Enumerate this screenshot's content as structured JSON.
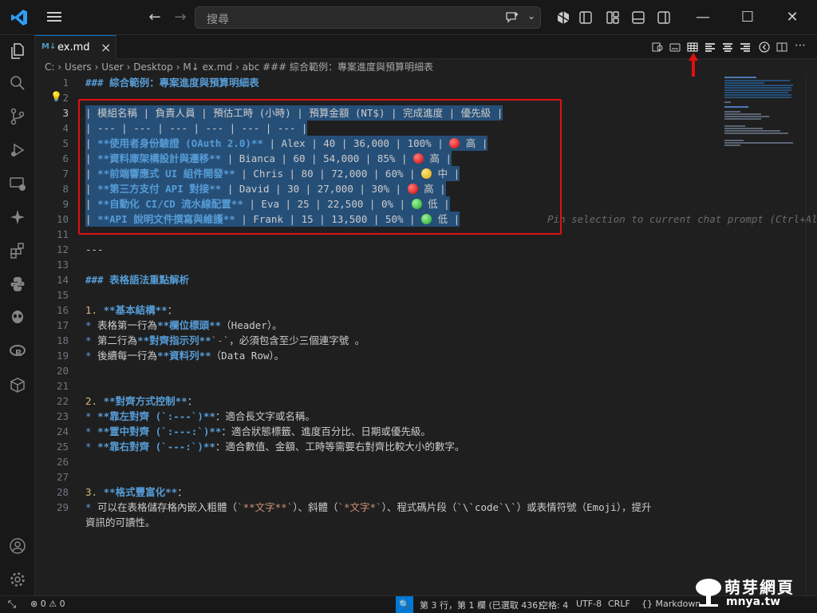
{
  "titlebar": {
    "search_placeholder": "搜尋",
    "menu_icon": "hamburger-menu-icon",
    "window_controls": [
      "minimize",
      "maximize",
      "close"
    ]
  },
  "tab": {
    "icon": "M↓",
    "label": "ex.md"
  },
  "breadcrumb": [
    "C:",
    "Users",
    "User",
    "Desktop",
    "M↓ ex.md",
    "abc ### 綜合範例：專案進度與預算明細表"
  ],
  "editor": {
    "ghost_text": "Pin selection to current chat prompt (Ctrl+Alt+X",
    "lines": [
      {
        "n": "1",
        "text": "### 綜合範例：專案進度與預算明細表"
      },
      {
        "n": "2",
        "text": ""
      },
      {
        "n": "3",
        "text": "| 模組名稱 | 負責人員 | 預估工時 (小時) | 預算金額 (NT$) | 完成進度 | 優先級 |"
      },
      {
        "n": "4",
        "text": "| --- | --- | --- | --- | --- | --- |"
      },
      {
        "n": "5",
        "pre": "| ",
        "b": "**使用者身份驗證 (OAuth 2.0)**",
        "post": " | Alex | 40 | 36,000 | 100% | ",
        "emoji": "red",
        "tail": " 高 |"
      },
      {
        "n": "6",
        "pre": "| ",
        "b": "**資料庫架構設計與遷移**",
        "post": " | Bianca | 60 | 54,000 | 85% | ",
        "emoji": "red",
        "tail": " 高 |"
      },
      {
        "n": "7",
        "pre": "| ",
        "b": "**前端響應式 UI 組件開發**",
        "post": " | Chris | 80 | 72,000 | 60% | ",
        "emoji": "yellow",
        "tail": " 中 |"
      },
      {
        "n": "8",
        "pre": "| ",
        "b": "**第三方支付 API 對接**",
        "post": " | David | 30 | 27,000 | 30% | ",
        "emoji": "red",
        "tail": " 高 |"
      },
      {
        "n": "9",
        "pre": "| ",
        "b": "**自動化 CI/CD 流水線配置**",
        "post": " | Eva | 25 | 22,500 | 0% | ",
        "emoji": "green",
        "tail": " 低 |"
      },
      {
        "n": "10",
        "pre": "| ",
        "b": "**API 說明文件撰寫與維護**",
        "post": " | Frank | 15 | 13,500 | 50% | ",
        "emoji": "green",
        "tail": " 低 |"
      },
      {
        "n": "11",
        "text": ""
      },
      {
        "n": "12",
        "text": "---"
      },
      {
        "n": "13",
        "text": ""
      },
      {
        "n": "14",
        "text": "### 表格語法重點解析"
      },
      {
        "n": "15",
        "text": ""
      },
      {
        "n": "16",
        "num": "1.",
        "b": "**基本結構**",
        "post": "："
      },
      {
        "n": "17",
        "bul": "*",
        "pre": " 表格第一行為",
        "b": "**欄位標頭**",
        "post": "（Header）。"
      },
      {
        "n": "18",
        "bul": "*",
        "pre": " 第二行為",
        "b": "**對齊指示列**",
        "post": "，必須包含至少三個連字號 ",
        "ic": "`-`",
        "tail": "。"
      },
      {
        "n": "19",
        "bul": "*",
        "pre": " 後續每一行為",
        "b": "**資料列**",
        "post": "（Data Row）。"
      },
      {
        "n": "20",
        "text": ""
      },
      {
        "n": "21",
        "text": ""
      },
      {
        "n": "22",
        "num": "2.",
        "b": "**對齊方式控制**",
        "post": "："
      },
      {
        "n": "23",
        "bul": "*",
        "pre": " ",
        "b": "**靠左對齊 (`:---`)**",
        "post": "：適合長文字或名稱。"
      },
      {
        "n": "24",
        "bul": "*",
        "pre": " ",
        "b": "**置中對齊 (`:---:`)**",
        "post": "：適合狀態標籤、進度百分比、日期或優先級。"
      },
      {
        "n": "25",
        "bul": "*",
        "pre": " ",
        "b": "**靠右對齊 (`---:`)**",
        "post": "：適合數值、金額、工時等需要右對齊比較大小的數字。"
      },
      {
        "n": "26",
        "text": ""
      },
      {
        "n": "27",
        "text": ""
      },
      {
        "n": "28",
        "num": "3.",
        "b": "**格式豐富化**",
        "post": "："
      },
      {
        "n": "29",
        "bul": "*",
        "pre": " 可以在表格儲存格內嵌入粗體（",
        "ic": "`**文字**`",
        "post": "）、斜體（",
        "ic2": "`*文字*`",
        "tail": "）、程式碼片段（`\\`code`\\`）或表情符號（Emoji），提升"
      },
      {
        "n": "",
        "text": "資訊的可讀性。"
      }
    ]
  },
  "statusbar": {
    "errors": "0",
    "warnings": "0",
    "position": "第 3 行，第 1 欄 (已選取 436)",
    "spaces": "空格: 4",
    "encoding": "UTF-8",
    "eol": "CRLF",
    "language": "Markdown"
  },
  "watermark": {
    "title": "萌芽網頁",
    "domain": "mnya.tw"
  },
  "colors": {
    "accent": "#0078d4",
    "highlight_box": "#e01010",
    "selection": "#264f78"
  }
}
